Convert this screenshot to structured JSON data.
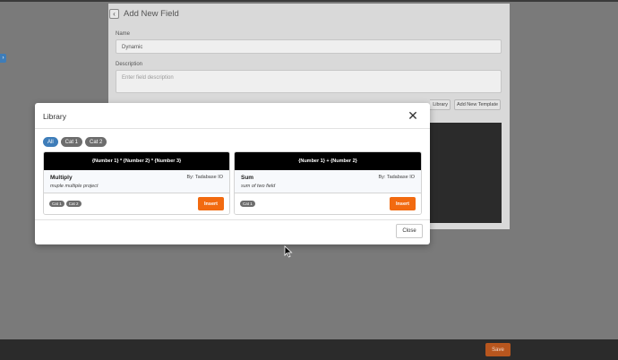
{
  "background": {
    "title": "Add New Field",
    "name_label": "Name",
    "name_value": "Dynamic",
    "description_label": "Description",
    "description_placeholder": "Enter field description",
    "library_button_partial": "Library",
    "add_template_button": "Add New Template",
    "save_button": "Save"
  },
  "modal": {
    "title": "Library",
    "close_icon": "close-icon",
    "filters": [
      {
        "label": "All",
        "active": true
      },
      {
        "label": "Cat 1",
        "active": false
      },
      {
        "label": "Cat 2",
        "active": false
      }
    ],
    "cards": [
      {
        "formula": "{Number 1} * {Number 2} * {Number 3}",
        "name": "Multiply",
        "author": "By: Tadabase IO",
        "description": "muple multiple project",
        "tags": [
          "Cat 1",
          "Cat 2"
        ],
        "insert_label": "Insert"
      },
      {
        "formula": "{Number 1} + {Number 2}",
        "name": "Sum",
        "author": "By: Tadabase IO",
        "description": "sum of two field",
        "tags": [
          "Cat 1"
        ],
        "insert_label": "Insert"
      }
    ],
    "close_button": "Close"
  },
  "colors": {
    "accent_blue": "#3e7db9",
    "insert_orange": "#f26a10",
    "save_orange": "#b8561e"
  }
}
